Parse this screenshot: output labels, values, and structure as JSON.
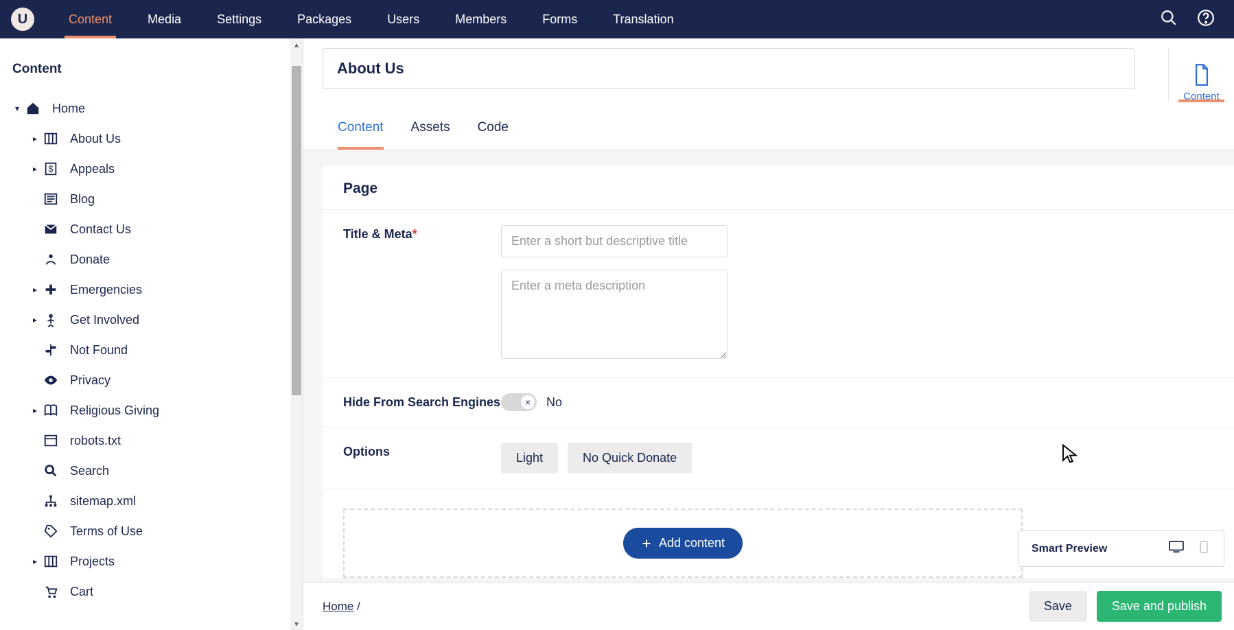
{
  "topnav": {
    "items": [
      {
        "label": "Content",
        "active": true
      },
      {
        "label": "Media"
      },
      {
        "label": "Settings"
      },
      {
        "label": "Packages"
      },
      {
        "label": "Users"
      },
      {
        "label": "Members"
      },
      {
        "label": "Forms"
      },
      {
        "label": "Translation"
      }
    ]
  },
  "sidebar": {
    "title": "Content",
    "root": {
      "label": "Home",
      "expanded": true
    },
    "items": [
      {
        "label": "About Us",
        "caret": true,
        "icon": "columns"
      },
      {
        "label": "Appeals",
        "caret": true,
        "icon": "dollar"
      },
      {
        "label": "Blog",
        "caret": false,
        "icon": "news"
      },
      {
        "label": "Contact Us",
        "caret": false,
        "icon": "mail"
      },
      {
        "label": "Donate",
        "caret": false,
        "icon": "hands"
      },
      {
        "label": "Emergencies",
        "caret": true,
        "icon": "plus"
      },
      {
        "label": "Get Involved",
        "caret": true,
        "icon": "person"
      },
      {
        "label": "Not Found",
        "caret": false,
        "icon": "signpost"
      },
      {
        "label": "Privacy",
        "caret": false,
        "icon": "eye"
      },
      {
        "label": "Religious Giving",
        "caret": true,
        "icon": "book"
      },
      {
        "label": "robots.txt",
        "caret": false,
        "icon": "window"
      },
      {
        "label": "Search",
        "caret": false,
        "icon": "search"
      },
      {
        "label": "sitemap.xml",
        "caret": false,
        "icon": "tree"
      },
      {
        "label": "Terms of Use",
        "caret": false,
        "icon": "pricetag"
      },
      {
        "label": "Projects",
        "caret": true,
        "icon": "columns"
      },
      {
        "label": "Cart",
        "caret": false,
        "icon": "cart"
      }
    ]
  },
  "document": {
    "title": "About Us",
    "tabs": [
      "Content",
      "Assets",
      "Code"
    ],
    "activeTab": 0,
    "rightApp": {
      "label": "Content"
    },
    "section": {
      "heading": "Page"
    },
    "fields": {
      "titleMeta": {
        "label": "Title & Meta",
        "required": true,
        "title_placeholder": "Enter a short but descriptive title",
        "meta_placeholder": "Enter a meta description"
      },
      "hideSearch": {
        "label": "Hide From Search Engines",
        "value_label": "No"
      },
      "options": {
        "label": "Options",
        "chips": [
          "Light",
          "No Quick Donate"
        ]
      }
    },
    "addContent": {
      "label": "Add content"
    },
    "preview": {
      "label": "Smart Preview"
    }
  },
  "footer": {
    "breadcrumb": {
      "home": "Home",
      "sep": "/"
    },
    "save": "Save",
    "publish": "Save and publish"
  }
}
